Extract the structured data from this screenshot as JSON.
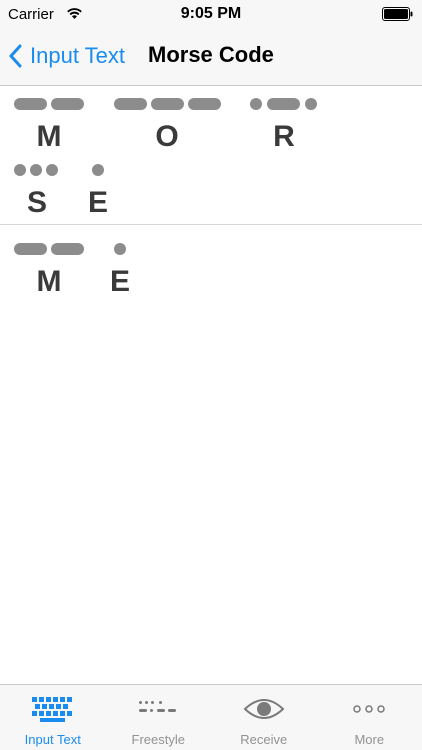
{
  "status_bar": {
    "carrier": "Carrier",
    "time": "9:05 PM",
    "wifi_icon": "wifi-icon",
    "battery_icon": "battery-icon"
  },
  "nav": {
    "back_label": "Input Text",
    "title": "Morse Code"
  },
  "words": [
    {
      "letters": [
        {
          "char": "M",
          "morse": "--"
        },
        {
          "char": "O",
          "morse": "---"
        },
        {
          "char": "R",
          "morse": ".-."
        },
        {
          "char": "S",
          "morse": "..."
        },
        {
          "char": "E",
          "morse": "."
        }
      ]
    },
    {
      "letters": [
        {
          "char": "M",
          "morse": "--"
        },
        {
          "char": "E",
          "morse": "."
        }
      ]
    }
  ],
  "tabs": [
    {
      "label": "Input Text",
      "icon": "keyboard-icon",
      "active": true
    },
    {
      "label": "Freestyle",
      "icon": "morse-dots-icon",
      "active": false
    },
    {
      "label": "Receive",
      "icon": "eye-icon",
      "active": false
    },
    {
      "label": "More",
      "icon": "more-dots-icon",
      "active": false
    }
  ],
  "colors": {
    "accent": "#1a8cf0",
    "morse_symbol": "#8c8c8c",
    "letter": "#3a3a3a",
    "inactive_tab": "#929292"
  }
}
